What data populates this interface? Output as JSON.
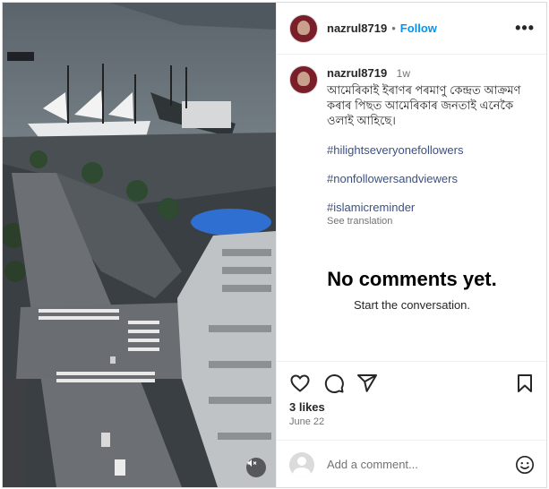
{
  "post": {
    "username": "nazrul8719",
    "follow_label": "Follow",
    "separator": "•",
    "more_label": "•••"
  },
  "caption": {
    "username": "nazrul8719",
    "time": "1w",
    "text": "আমেৰিকাই ইৰাণৰ পৰমাণু কেন্দ্ৰত আক্ৰমণ কৰাৰ পিছত আমেৰিকাৰ জনতাই এনেকৈ ওলাই আহিছে।",
    "hashtags": [
      "#hilightseveryonefollowers",
      "#nonfollowersandviewers",
      "#islamicreminder"
    ],
    "see_translation": "See translation"
  },
  "comments": {
    "empty_title": "No comments yet.",
    "empty_subtitle": "Start the conversation."
  },
  "stats": {
    "likes": "3 likes",
    "date": "June 22"
  },
  "comment_box": {
    "placeholder": "Add a comment..."
  },
  "icons": {
    "like": "heart-icon",
    "comment": "comment-icon",
    "share": "share-icon",
    "save": "bookmark-icon",
    "mute": "muted-speaker-icon",
    "emoji": "emoji-icon"
  }
}
